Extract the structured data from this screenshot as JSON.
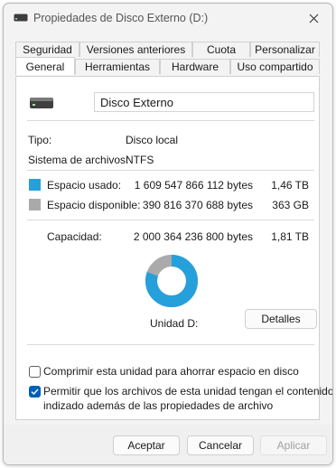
{
  "window": {
    "title": "Propiedades de Disco Externo (D:)",
    "title_icon": "drive-icon",
    "close_icon": "close-icon"
  },
  "tabs": {
    "row1": [
      {
        "label": "Seguridad"
      },
      {
        "label": "Versiones anteriores"
      },
      {
        "label": "Cuota"
      },
      {
        "label": "Personalizar"
      }
    ],
    "row2": [
      {
        "label": "General",
        "active": true
      },
      {
        "label": "Herramientas"
      },
      {
        "label": "Hardware"
      },
      {
        "label": "Uso compartido"
      }
    ]
  },
  "general": {
    "drive_name": "Disco  Externo",
    "type_label": "Tipo:",
    "type_value": "Disco local",
    "fs_label": "Sistema de archivos:",
    "fs_value": "NTFS",
    "used": {
      "label": "Espacio usado:",
      "bytes": "1 609 547 866 112 bytes",
      "size": "1,46 TB",
      "color": "#26a0da"
    },
    "free": {
      "label": "Espacio disponible:",
      "bytes": "390 816 370 688 bytes",
      "size": "363 GB",
      "color": "#aaaaaa"
    },
    "capacity": {
      "label": "Capacidad:",
      "bytes": "2 000 364 236 800 bytes",
      "size": "1,81 TB"
    },
    "used_fraction": 0.8046,
    "drive_caption": "Unidad D:",
    "details_button": "Detalles",
    "compress_label": "Comprimir esta unidad para ahorrar espacio en disco",
    "compress_checked": false,
    "index_label_line1": "Permitir que los archivos de esta unidad tengan el contenido",
    "index_label_line2": "indizado además de las propiedades de archivo",
    "index_checked": true
  },
  "buttons": {
    "ok": "Aceptar",
    "cancel": "Cancelar",
    "apply": "Aplicar"
  }
}
